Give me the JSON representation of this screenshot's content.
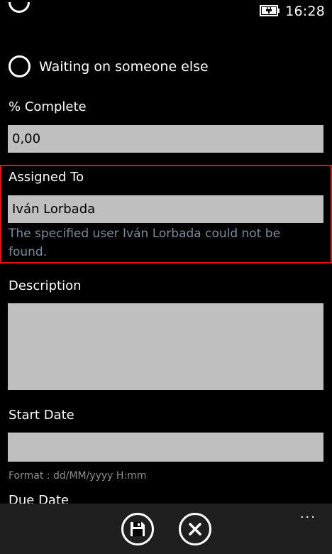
{
  "status": {
    "time": "16:28",
    "battery_icon": "battery-charging-icon"
  },
  "status_options": {
    "waiting_label": "Waiting on someone else"
  },
  "percent_complete": {
    "label": "% Complete",
    "value": "0,00"
  },
  "assigned_to": {
    "label": "Assigned To",
    "value": "Iván Lorbada",
    "error": "The specified user Iván Lorbada could not be found.",
    "error_border_color": "#e51414"
  },
  "description": {
    "label": "Description",
    "value": ""
  },
  "start_date": {
    "label": "Start Date",
    "value": "",
    "format_hint": "Format : dd/MM/yyyy H:mm"
  },
  "due_date": {
    "label": "Due Date"
  },
  "app_bar": {
    "save_icon": "save-icon",
    "cancel_icon": "cancel-icon",
    "more": "..."
  },
  "colors": {
    "background": "#000000",
    "input_fill": "#bfbfbf",
    "app_bar": "#1f1f1f",
    "error_text": "#7c8a9c"
  }
}
